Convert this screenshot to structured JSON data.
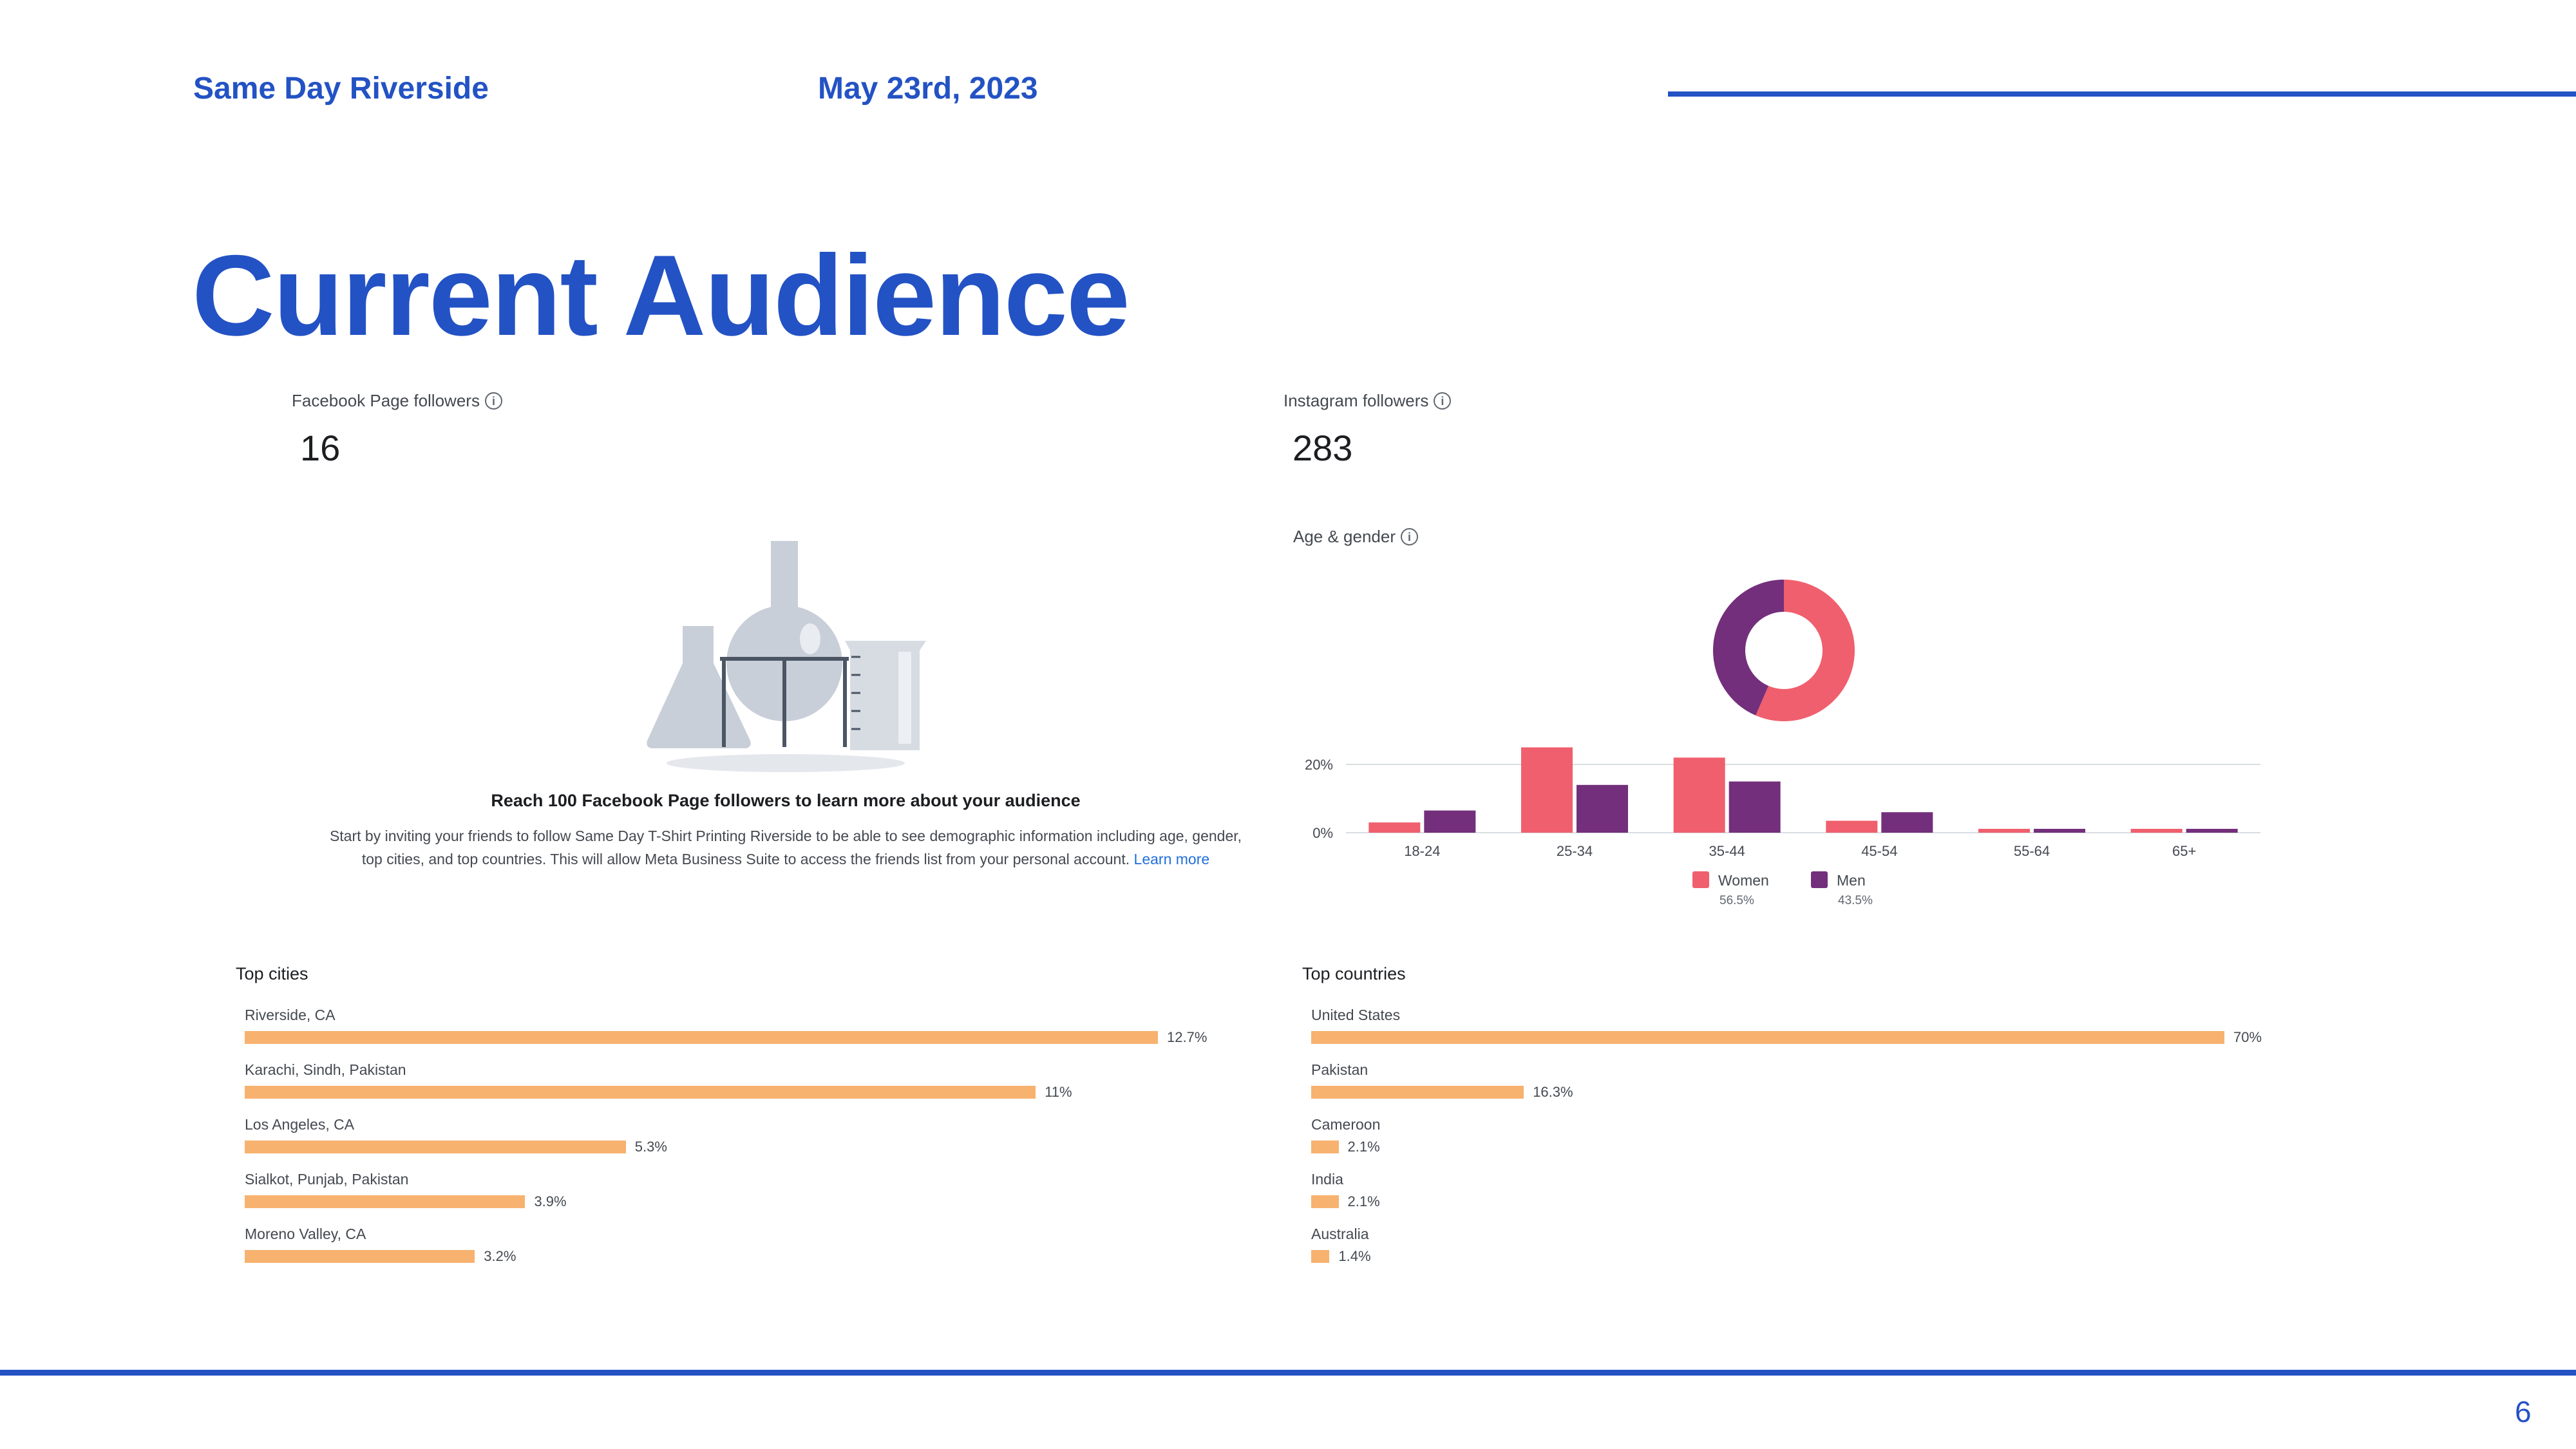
{
  "header": {
    "brand": "Same Day Riverside",
    "date": "May 23rd, 2023",
    "title": "Current Audience",
    "page_number": "6"
  },
  "facebook": {
    "label": "Facebook Page followers",
    "value": "16",
    "info_icon": "info-icon",
    "illustration": "lab-flasks-illustration",
    "reach_title": "Reach 100 Facebook Page followers to learn more about your audience",
    "reach_body": "Start by inviting your friends to follow Same Day T-Shirt Printing Riverside to be able to see demographic information including age, gender, top cities, and top countries. This will allow Meta Business Suite to access the friends list from your personal account.",
    "learn_more": "Learn more"
  },
  "instagram": {
    "label": "Instagram followers",
    "value": "283",
    "info_icon": "info-icon",
    "age_gender_label": "Age & gender"
  },
  "colors": {
    "brand_blue": "#2352c4",
    "women": "#f05f6d",
    "men": "#732f7b",
    "bar": "#f7b26f"
  },
  "chart_data": [
    {
      "type": "pie",
      "title": "",
      "categories": [
        "Women",
        "Men"
      ],
      "values": [
        56.5,
        43.5
      ],
      "colors": [
        "#f05f6d",
        "#732f7b"
      ],
      "donut": true
    },
    {
      "type": "bar",
      "title": "Age & gender",
      "categories": [
        "18-24",
        "25-34",
        "35-44",
        "45-54",
        "55-64",
        "65+"
      ],
      "series": [
        {
          "name": "Women",
          "values": [
            3,
            25,
            22,
            3.5,
            1,
            1
          ],
          "color": "#f05f6d",
          "total": "56.5%"
        },
        {
          "name": "Men",
          "values": [
            6.5,
            14,
            15,
            6,
            1,
            1
          ],
          "color": "#732f7b",
          "total": "43.5%"
        }
      ],
      "ylim": [
        0,
        28
      ],
      "yticks": [
        {
          "value": 0,
          "label": "0%"
        },
        {
          "value": 20,
          "label": "20%"
        }
      ],
      "grid": true,
      "legend": "bottom"
    },
    {
      "type": "bar",
      "orientation": "horizontal",
      "title": "Top cities",
      "categories": [
        "Riverside, CA",
        "Karachi, Sindh, Pakistan",
        "Los Angeles, CA",
        "Sialkot, Punjab, Pakistan",
        "Moreno Valley, CA"
      ],
      "values": [
        12.7,
        11,
        5.3,
        3.9,
        3.2
      ],
      "labels": [
        "12.7%",
        "11%",
        "5.3%",
        "3.9%",
        "3.2%"
      ],
      "xlim": [
        0,
        12.7
      ]
    },
    {
      "type": "bar",
      "orientation": "horizontal",
      "title": "Top countries",
      "categories": [
        "United States",
        "Pakistan",
        "Cameroon",
        "India",
        "Australia"
      ],
      "values": [
        70,
        16.3,
        2.1,
        2.1,
        1.4
      ],
      "labels": [
        "70%",
        "16.3%",
        "2.1%",
        "2.1%",
        "1.4%"
      ],
      "xlim": [
        0,
        70
      ]
    }
  ]
}
